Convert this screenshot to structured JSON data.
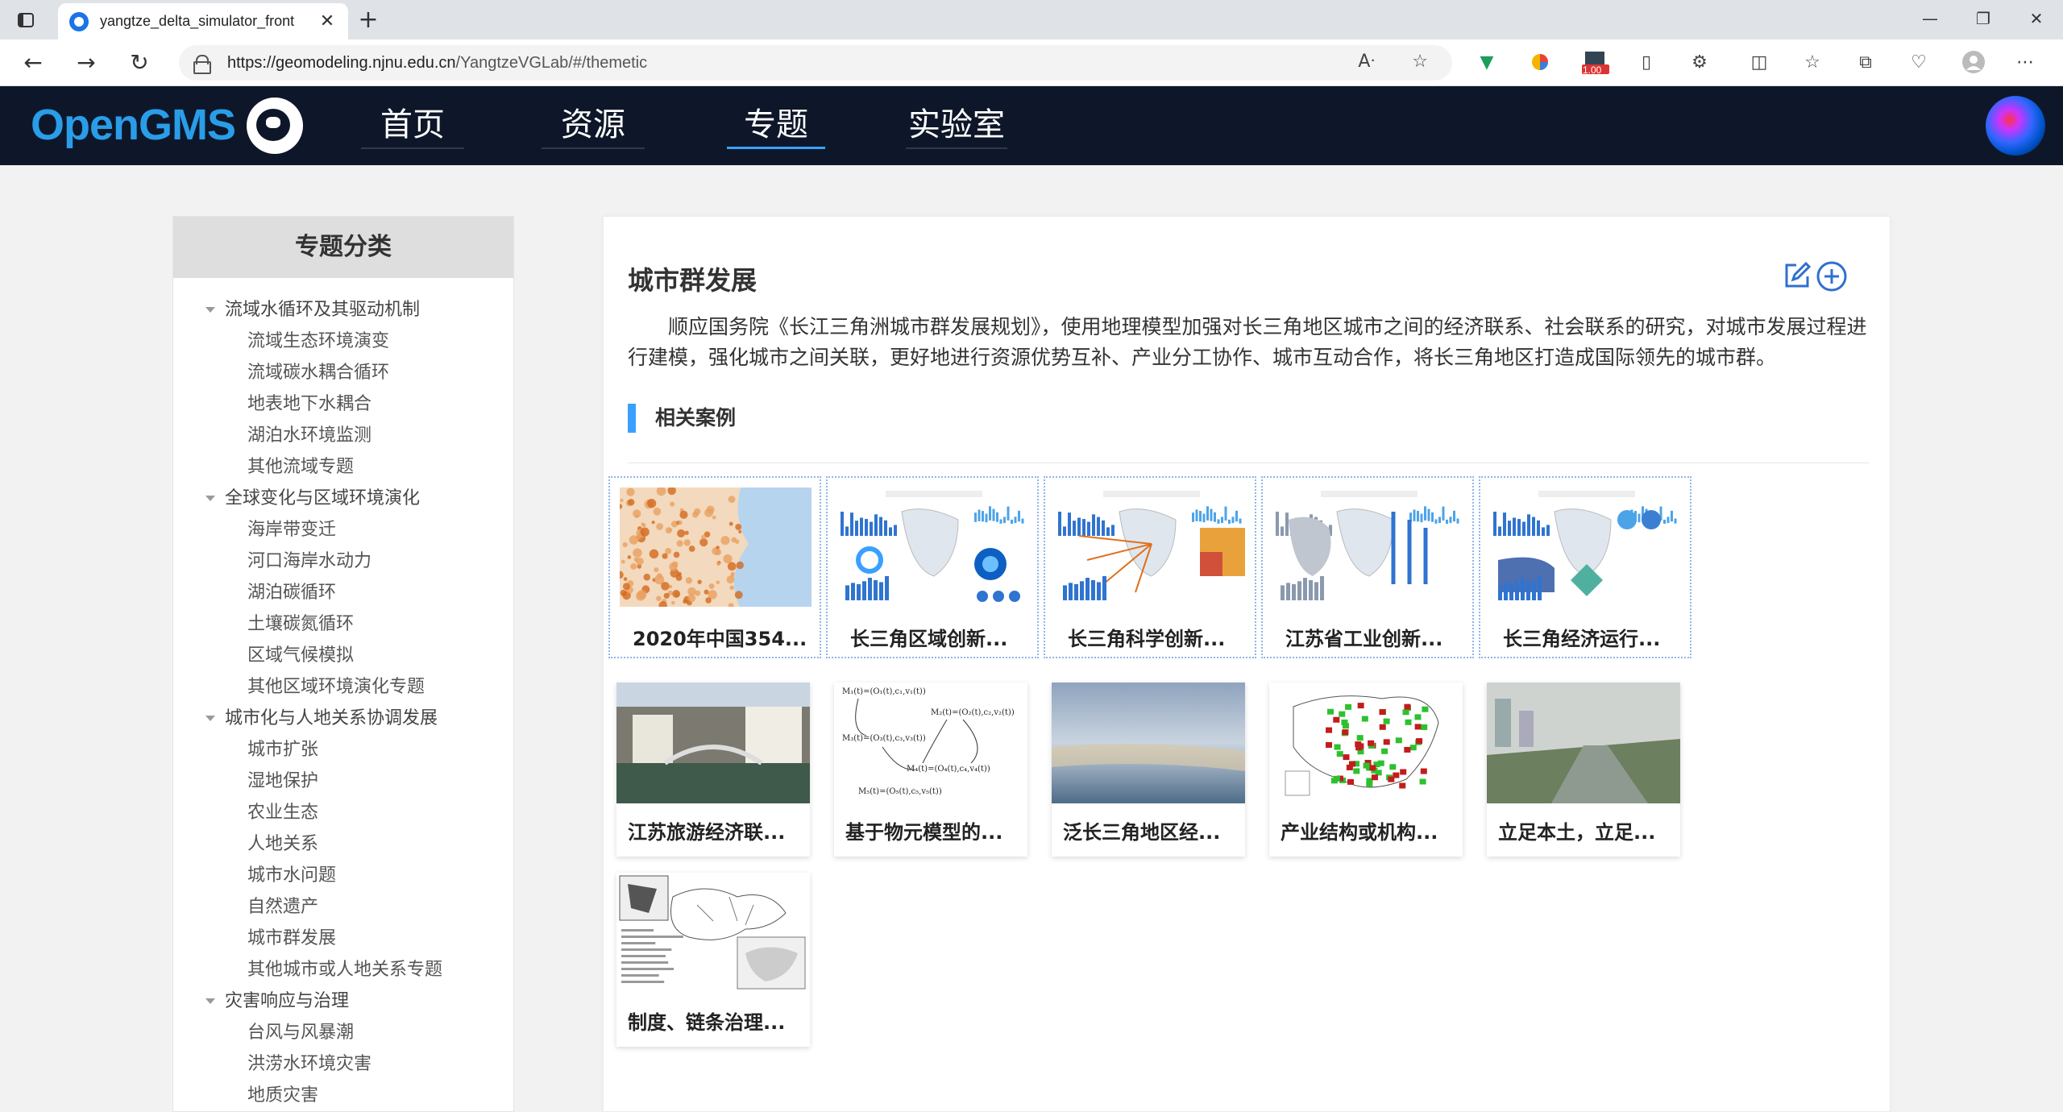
{
  "browser": {
    "tab_title": "yangtze_delta_simulator_front",
    "url_host": "https://geomodeling.njnu.edu.cn",
    "url_path": "/YangtzeVGLab/#/themetic",
    "badge": "1.00"
  },
  "header": {
    "logo_text_o": "O",
    "logo_text_rest": "penGMS",
    "nav": [
      {
        "label": "首页",
        "active": false
      },
      {
        "label": "资源",
        "active": false
      },
      {
        "label": "专题",
        "active": true
      },
      {
        "label": "实验室",
        "active": false
      }
    ]
  },
  "sidebar": {
    "title": "专题分类",
    "tree": [
      {
        "label": "流域水循环及其驱动机制",
        "children": [
          "流域生态环境演变",
          "流域碳水耦合循环",
          "地表地下水耦合",
          "湖泊水环境监测",
          "其他流域专题"
        ]
      },
      {
        "label": "全球变化与区域环境演化",
        "children": [
          "海岸带变迁",
          "河口海岸水动力",
          "湖泊碳循环",
          "土壤碳氮循环",
          "区域气候模拟",
          "其他区域环境演化专题"
        ]
      },
      {
        "label": "城市化与人地关系协调发展",
        "children": [
          "城市扩张",
          "湿地保护",
          "农业生态",
          "人地关系",
          "城市水问题",
          "自然遗产",
          "城市群发展",
          "其他城市或人地关系专题"
        ]
      },
      {
        "label": "灾害响应与治理",
        "children": [
          "台风与风暴潮",
          "洪涝水环境灾害",
          "地质灾害"
        ]
      }
    ]
  },
  "main": {
    "title": "城市群发展",
    "description": "顺应国务院《长江三角洲城市群发展规划》，使用地理模型加强对长三角地区城市之间的经济联系、社会联系的研究，对城市发展过程进行建模，强化城市之间关联，更好地进行资源优势互补、产业分工协作、城市互动合作，将长三角地区打造成国际领先的城市群。",
    "section_title": "相关案例",
    "cards": [
      {
        "label": "2020年中国354...",
        "thumb": "map-orange"
      },
      {
        "label": "长三角区域创新...",
        "thumb": "dashboard-blue"
      },
      {
        "label": "长三角科学创新...",
        "thumb": "dashboard-flow"
      },
      {
        "label": "江苏省工业创新...",
        "thumb": "dashboard-gray"
      },
      {
        "label": "长三角经济运行...",
        "thumb": "dashboard-multi"
      },
      {
        "label": "江苏旅游经济联...",
        "thumb": "photo-town"
      },
      {
        "label": "基于物元模型的...",
        "thumb": "formula-diagram"
      },
      {
        "label": "泛长三角地区经...",
        "thumb": "photo-sea"
      },
      {
        "label": "产业结构或机构...",
        "thumb": "map-china-red-green"
      },
      {
        "label": "立足本土，立足...",
        "thumb": "photo-river"
      },
      {
        "label": "制度、链条治理...",
        "thumb": "map-line"
      }
    ]
  },
  "colors": {
    "header_bg": "#0e1729",
    "accent": "#3aa0ff",
    "logo": "#2a9de8"
  }
}
